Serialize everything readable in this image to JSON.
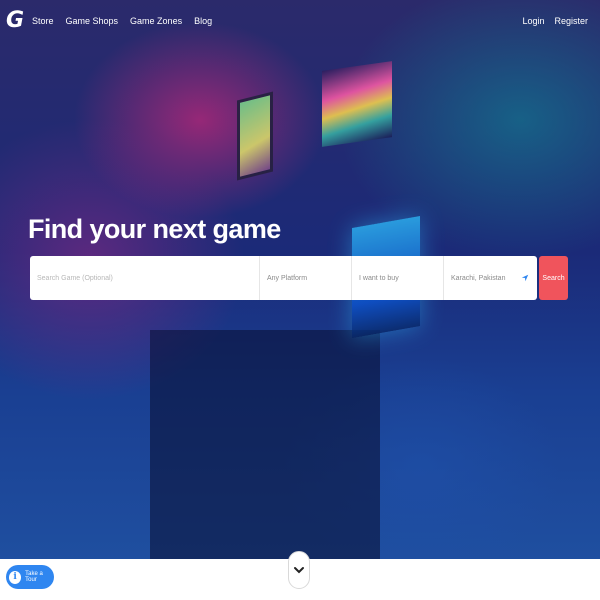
{
  "header": {
    "logo_text": "G",
    "nav": [
      {
        "label": "Store"
      },
      {
        "label": "Game Shops"
      },
      {
        "label": "Game Zones"
      },
      {
        "label": "Blog"
      }
    ],
    "auth": [
      {
        "label": "Login"
      },
      {
        "label": "Register"
      }
    ]
  },
  "hero": {
    "title": "Find your next game"
  },
  "search": {
    "game_placeholder": "Search Game (Optional)",
    "platform_value": "Any Platform",
    "intent_value": "I want to buy",
    "location_value": "Karachi, Pakistan",
    "location_icon": "location-arrow-icon",
    "submit_label": "Search",
    "submit_color": "#f0545c"
  },
  "footer": {
    "tour_label": "Take a Tour",
    "tour_icon": "info-icon",
    "tour_color": "#2f86f0",
    "scroll_icon": "chevron-down-icon"
  }
}
